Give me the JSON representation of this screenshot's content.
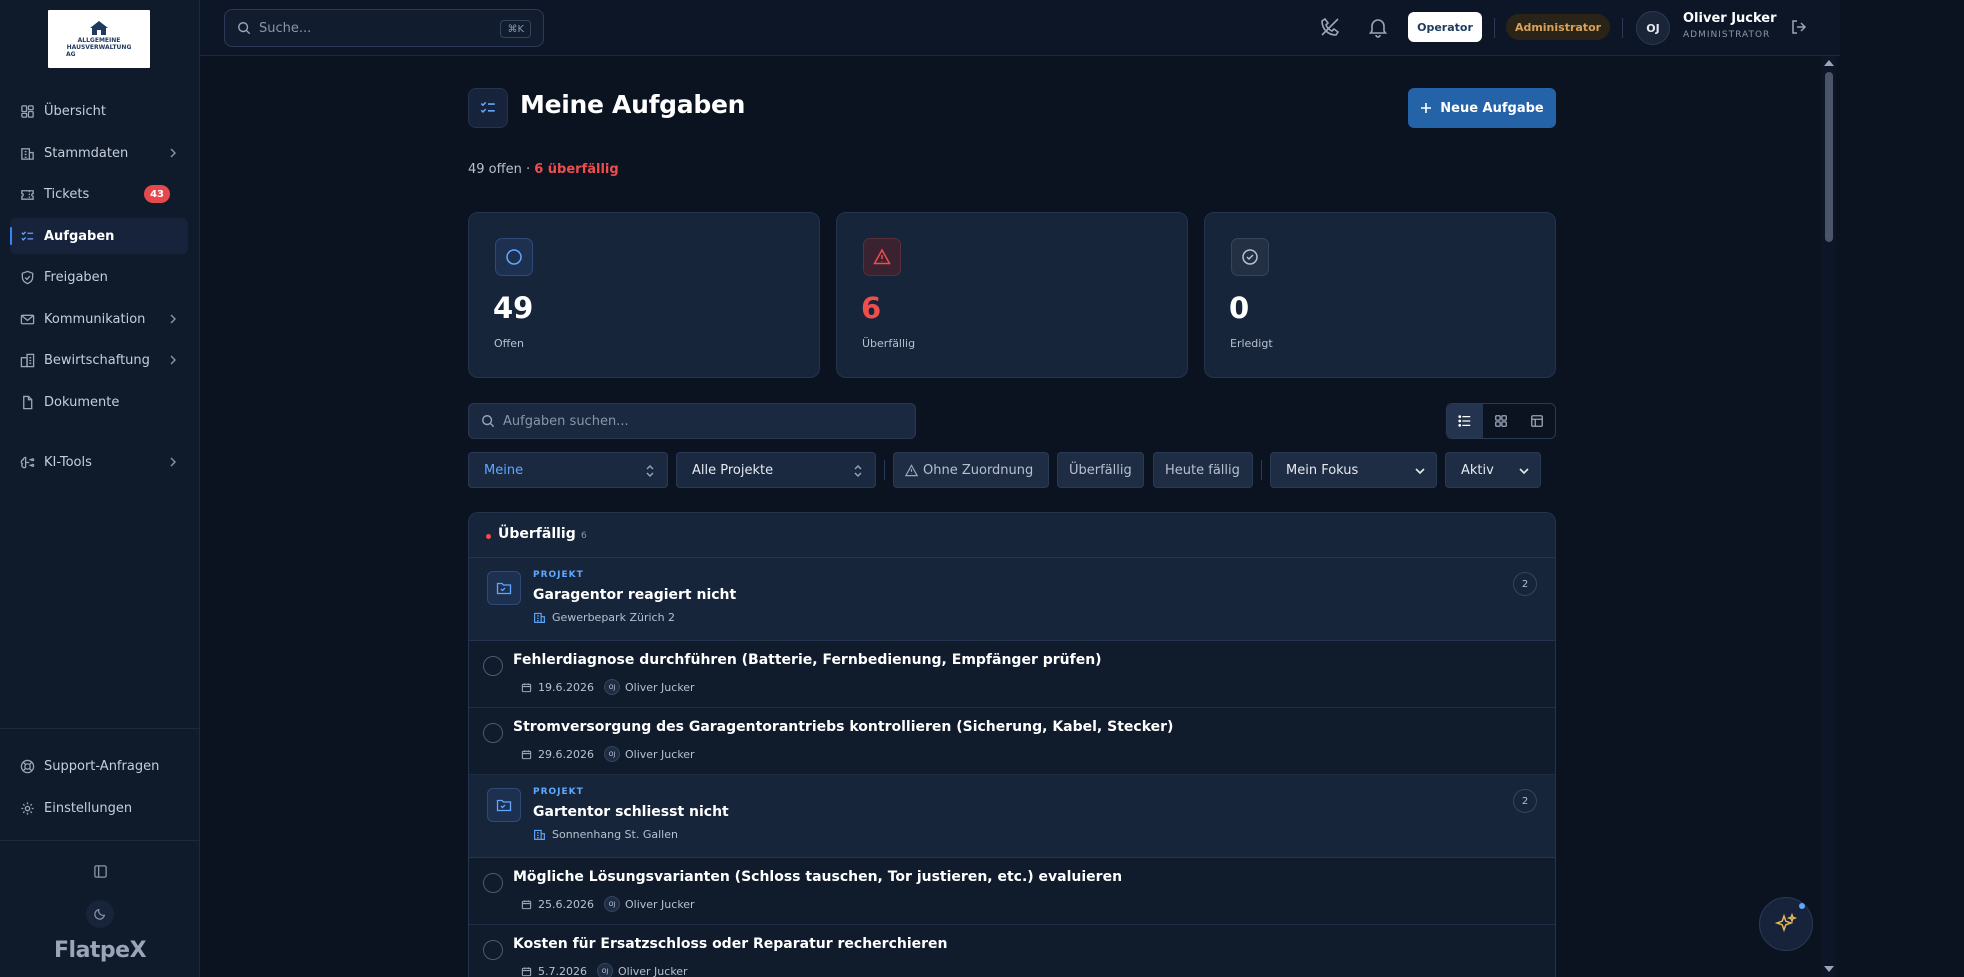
{
  "app": {
    "brand": "FlatpeX"
  },
  "logo": {
    "line1": "ALLGEMEINE",
    "line2": "HAUSVERWALTUNG",
    "line3": "AG"
  },
  "sidebar": {
    "items": [
      {
        "label": "Übersicht",
        "icon": "grid-icon"
      },
      {
        "label": "Stammdaten",
        "icon": "building-icon"
      },
      {
        "label": "Tickets",
        "icon": "ticket-icon",
        "badge": "43"
      },
      {
        "label": "Aufgaben",
        "icon": "list-check-icon",
        "active": true
      },
      {
        "label": "Freigaben",
        "icon": "shield-check-icon"
      },
      {
        "label": "Kommunikation",
        "icon": "mail-icon"
      },
      {
        "label": "Bewirtschaftung",
        "icon": "buildings-icon"
      },
      {
        "label": "Dokumente",
        "icon": "file-icon"
      },
      {
        "label": "KI-Tools",
        "icon": "brain-icon"
      }
    ],
    "bottom": [
      {
        "label": "Support-Anfragen",
        "icon": "lifebuoy-icon"
      },
      {
        "label": "Einstellungen",
        "icon": "gear-icon"
      }
    ]
  },
  "topbar": {
    "search_placeholder": "Suche...",
    "shortcut": "⌘K",
    "operator_label": "Operator",
    "admin_label": "Administrator",
    "user": {
      "initials": "OJ",
      "name": "Oliver Jucker",
      "role": "ADMINISTRATOR"
    }
  },
  "page": {
    "title": "Meine Aufgaben",
    "new_button": "Neue Aufgabe",
    "summary_open": "49 offen · ",
    "summary_overdue": "6 überfällig"
  },
  "stats": [
    {
      "value": "49",
      "label": "Offen",
      "color": "#ffffff"
    },
    {
      "value": "6",
      "label": "Überfällig",
      "color": "#f04d4d"
    },
    {
      "value": "0",
      "label": "Erledigt",
      "color": "#ffffff"
    }
  ],
  "filters": {
    "search_placeholder": "Aufgaben suchen...",
    "scope": "Meine",
    "project": "Alle Projekte",
    "chips": [
      "Ohne Zuordnung",
      "Überfällig",
      "Heute fällig"
    ],
    "focus": "Mein Fokus",
    "status": "Aktiv"
  },
  "group": {
    "title": "Überfällig",
    "count": "6"
  },
  "projects": [
    {
      "kicker": "PROJEKT",
      "title": "Garagentor reagiert nicht",
      "location": "Gewerbepark Zürich 2",
      "count": "2"
    },
    {
      "kicker": "PROJEKT",
      "title": "Gartentor schliesst nicht",
      "location": "Sonnenhang St. Gallen",
      "count": "2"
    }
  ],
  "tasks": [
    {
      "title": "Fehlerdiagnose durchführen (Batterie, Fernbedienung, Empfänger prüfen)",
      "date": "19.6.2026",
      "initials": "OJ",
      "assignee": "Oliver Jucker"
    },
    {
      "title": "Stromversorgung des Garagentorantriebs kontrollieren (Sicherung, Kabel, Stecker)",
      "date": "29.6.2026",
      "initials": "OJ",
      "assignee": "Oliver Jucker"
    },
    {
      "title": "Mögliche Lösungsvarianten (Schloss tauschen, Tor justieren, etc.) evaluieren",
      "date": "25.6.2026",
      "initials": "OJ",
      "assignee": "Oliver Jucker"
    },
    {
      "title": "Kosten für Ersatzschloss oder Reparatur recherchieren",
      "date": "5.7.2026",
      "initials": "OJ",
      "assignee": "Oliver Jucker"
    }
  ],
  "colors": {
    "accent": "#2563a8",
    "danger": "#f04d4d",
    "background": "#0b1220"
  }
}
